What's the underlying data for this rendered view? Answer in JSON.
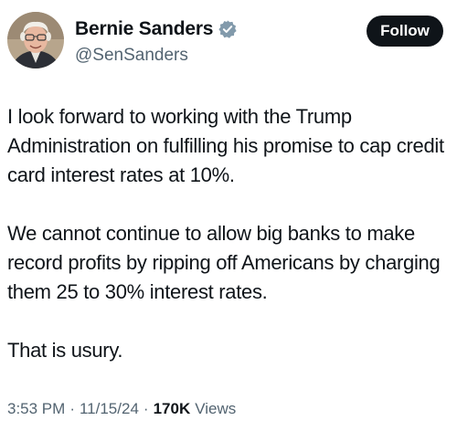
{
  "author": {
    "display_name": "Bernie Sanders",
    "handle": "@SenSanders",
    "verified_icon": "verified-badge-icon",
    "verified_color": "#829aab"
  },
  "follow_button": {
    "label": "Follow",
    "bg_color": "#0f1419",
    "text_color": "#ffffff"
  },
  "tweet": {
    "paragraphs": [
      "I look forward to working with the Trump Administration on fulfilling his promise to cap credit card interest rates at 10%.",
      "We cannot continue to allow big banks to make record profits by ripping off Americans by charging them 25 to 30% interest rates.",
      "That is usury."
    ]
  },
  "meta": {
    "time": "3:53 PM",
    "date": "11/15/24",
    "separator": "·",
    "views_count": "170K",
    "views_label": "Views"
  },
  "colors": {
    "text_primary": "#0f1419",
    "text_secondary": "#536471",
    "background": "#ffffff"
  }
}
